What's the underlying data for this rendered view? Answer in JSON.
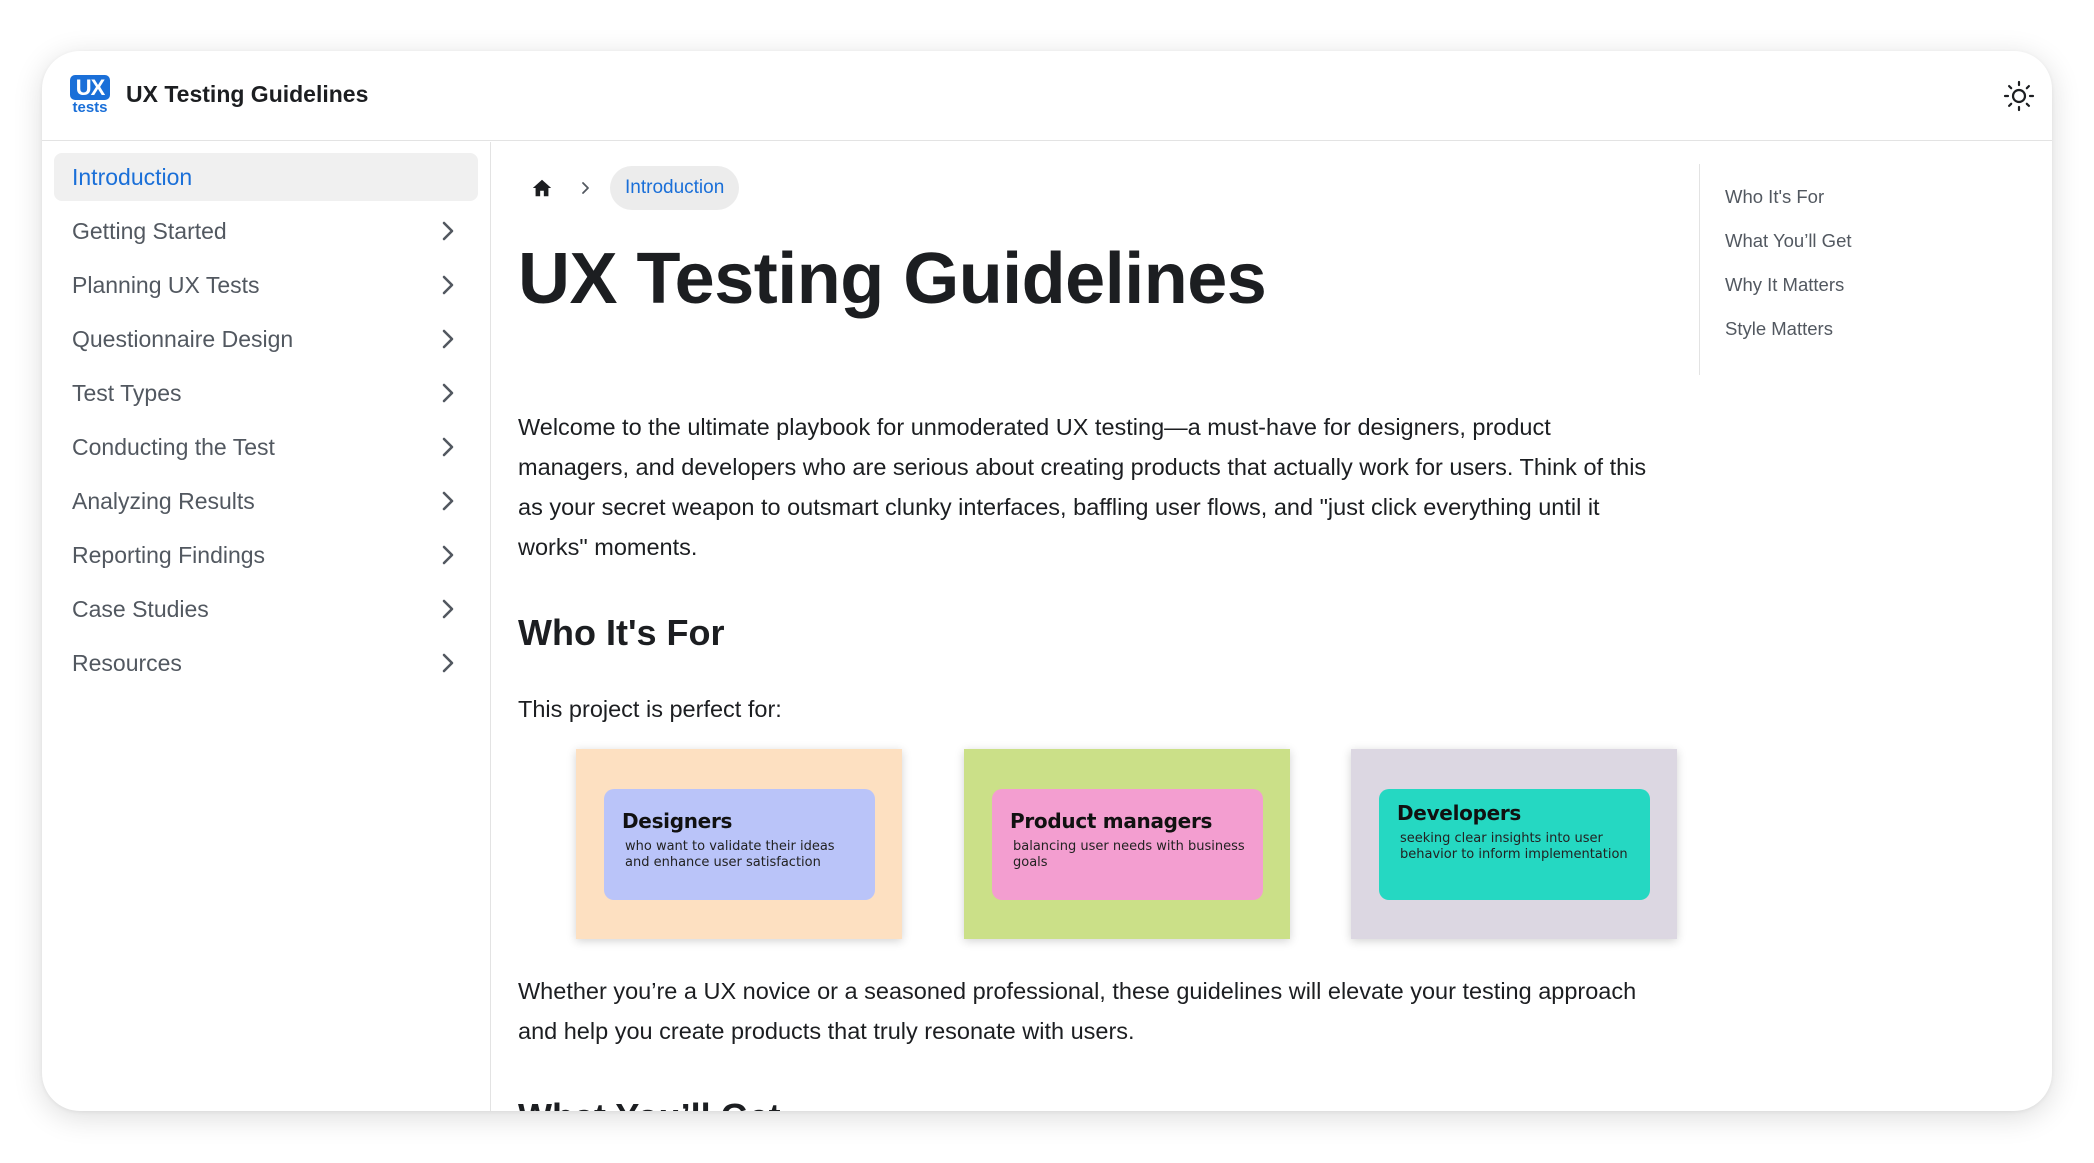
{
  "navbar": {
    "logo_top": "UX",
    "logo_bottom": "tests",
    "title": "UX Testing Guidelines"
  },
  "sidebar": {
    "items": [
      {
        "label": "Introduction",
        "active": true
      },
      {
        "label": "Getting Started"
      },
      {
        "label": "Planning UX Tests"
      },
      {
        "label": "Questionnaire Design"
      },
      {
        "label": "Test Types"
      },
      {
        "label": "Conducting the Test"
      },
      {
        "label": "Analyzing Results"
      },
      {
        "label": "Reporting Findings"
      },
      {
        "label": "Case Studies"
      },
      {
        "label": "Resources"
      }
    ]
  },
  "breadcrumb": {
    "current": "Introduction"
  },
  "main": {
    "title": "UX Testing Guidelines",
    "intro": "Welcome to the ultimate playbook for unmoderated UX testing—a must-have for designers, product managers, and developers who are serious about creating products that actually work for users. Think of this as your secret weapon to outsmart clunky interfaces, baffling user flows, and \"just click everything until it works\" moments.",
    "section1_heading": "Who It's For",
    "section1_lead": "This project is perfect for:",
    "cards": [
      {
        "title": "Designers",
        "desc": "who want to validate their ideas and enhance user satisfaction",
        "bg": "#fde0c1",
        "inner": "#bac4f9"
      },
      {
        "title": "Product managers",
        "desc": "balancing user needs with business goals",
        "bg": "#cbe088",
        "inner": "#f39ed0"
      },
      {
        "title": "Developers",
        "desc": "seeking clear insights into user behavior to inform implementation",
        "bg": "#dcd7e2",
        "inner": "#25d8c2"
      }
    ],
    "closing": "Whether you’re a UX novice or a seasoned professional, these guidelines will elevate your testing approach and help you create products that truly resonate with users.",
    "section2_heading": "What You’ll Get"
  },
  "toc": {
    "items": [
      "Who It's For",
      "What You’ll Get",
      "Why It Matters",
      "Style Matters"
    ]
  },
  "colors": {
    "accent": "#1a6fd8",
    "sidebar_text": "#525860",
    "active_bg": "#f0f0f0"
  },
  "icons": {
    "theme": "sun-icon",
    "home": "home-icon",
    "chevron": "chevron-right-icon"
  }
}
